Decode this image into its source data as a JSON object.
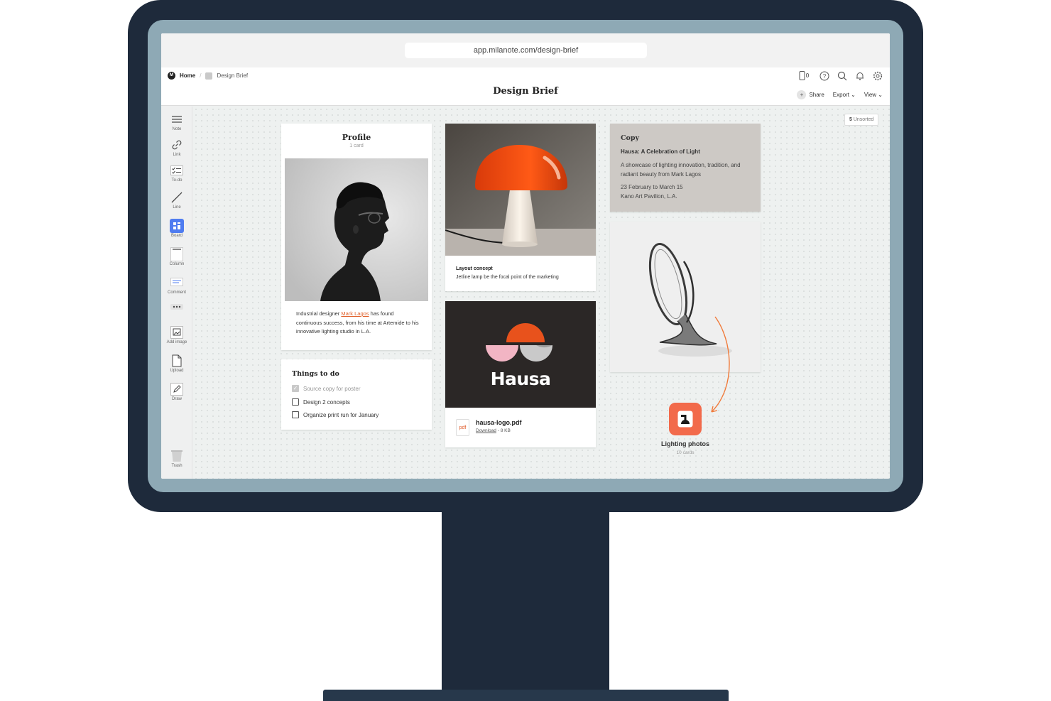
{
  "browser": {
    "url": "app.milanote.com/design-brief"
  },
  "header": {
    "breadcrumb_home": "Home",
    "breadcrumb_sep": "/",
    "breadcrumb_board": "Design Brief",
    "device_count": "0",
    "title": "Design Brief",
    "share_label": "Share",
    "export_label": "Export",
    "view_label": "View"
  },
  "toolbar": {
    "note": "Note",
    "link": "Link",
    "todo": "To-do",
    "line": "Line",
    "board": "Board",
    "column": "Column",
    "comment": "Comment",
    "add_image": "Add image",
    "upload": "Upload",
    "draw": "Draw",
    "trash": "Trash"
  },
  "canvas": {
    "unsorted_count": "5",
    "unsorted_label": "Unsorted",
    "profile": {
      "title": "Profile",
      "subtitle": "1 card",
      "text_before": "Industrial designer ",
      "text_link": "Mark Lagos",
      "text_after": " has found continuous success, from his time at Artemide to his innovative lighting studio in L.A."
    },
    "todo": {
      "title": "Things to do",
      "items": [
        {
          "label": "Source copy for poster",
          "done": true
        },
        {
          "label": "Design 2 concepts",
          "done": false
        },
        {
          "label": "Organize print run for January",
          "done": false
        }
      ]
    },
    "layout": {
      "title": "Layout concept",
      "text": "Jetline lamp be the focal point of the marketing"
    },
    "file": {
      "logo_word": "Hausa",
      "type_label": "pdf",
      "name": "hausa-logo.pdf",
      "download": "Download",
      "size": " - 8 KB"
    },
    "copy": {
      "label": "Copy",
      "heading": "Hausa: A Celebration of Light",
      "body": "A showcase of lighting innovation, tradition, and radiant beauty from Mark Lagos",
      "dates": "23 February to March 15",
      "venue": "Kano Art Pavilion, L.A."
    },
    "lighting": {
      "title": "Lighting photos",
      "subtitle": "10 cards"
    }
  },
  "colors": {
    "accent": "#f26a4b",
    "link": "#e0602a",
    "board_blue": "#4f7cf0",
    "monitor": "#1e2a3b"
  }
}
